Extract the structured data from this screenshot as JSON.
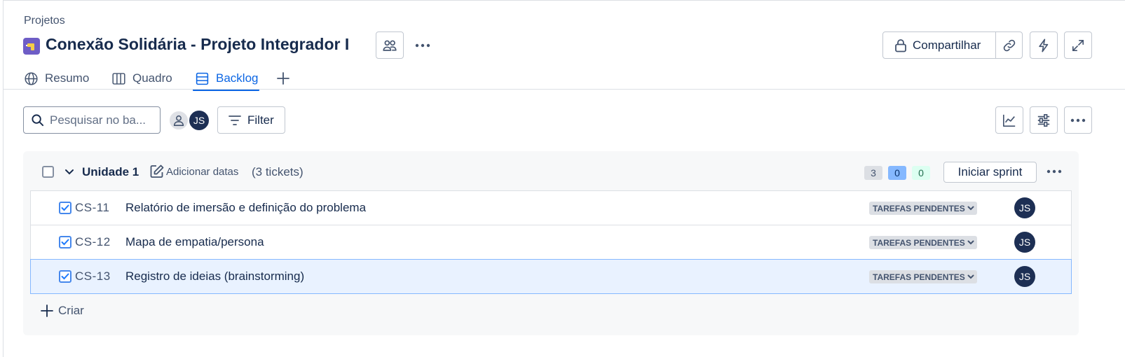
{
  "breadcrumb": "Projetos",
  "project": {
    "title": "Conexão Solidária - Projeto Integrador I"
  },
  "header_actions": {
    "share_label": "Compartilhar"
  },
  "tabs": [
    {
      "label": "Resumo",
      "icon": "globe-icon"
    },
    {
      "label": "Quadro",
      "icon": "board-icon"
    },
    {
      "label": "Backlog",
      "icon": "backlog-icon",
      "active": true
    }
  ],
  "toolbar": {
    "search_placeholder": "Pesquisar no ba...",
    "avatar_initials": "JS",
    "filter_label": "Filter"
  },
  "sprint": {
    "name": "Unidade 1",
    "add_dates_label": "Adicionar datas",
    "ticket_count_label": "(3 tickets)",
    "counts": {
      "todo": "3",
      "in_progress": "0",
      "done": "0"
    },
    "start_label": "Iniciar sprint",
    "create_label": "Criar"
  },
  "issues": [
    {
      "key": "CS-11",
      "summary": "Relatório de imersão e definição do problema",
      "status": "TAREFAS PENDENTES",
      "assignee": "JS"
    },
    {
      "key": "CS-12",
      "summary": "Mapa de empatia/persona",
      "status": "TAREFAS PENDENTES",
      "assignee": "JS"
    },
    {
      "key": "CS-13",
      "summary": "Registro de ideias (brainstorming)",
      "status": "TAREFAS PENDENTES",
      "assignee": "JS",
      "selected": true
    }
  ],
  "colors": {
    "accent": "#0c66e4",
    "avatar": "#1d2f54",
    "project_icon": "#6e5dc6",
    "status_badge": "#dcdfe4",
    "selected_row": "#e9f2ff"
  }
}
